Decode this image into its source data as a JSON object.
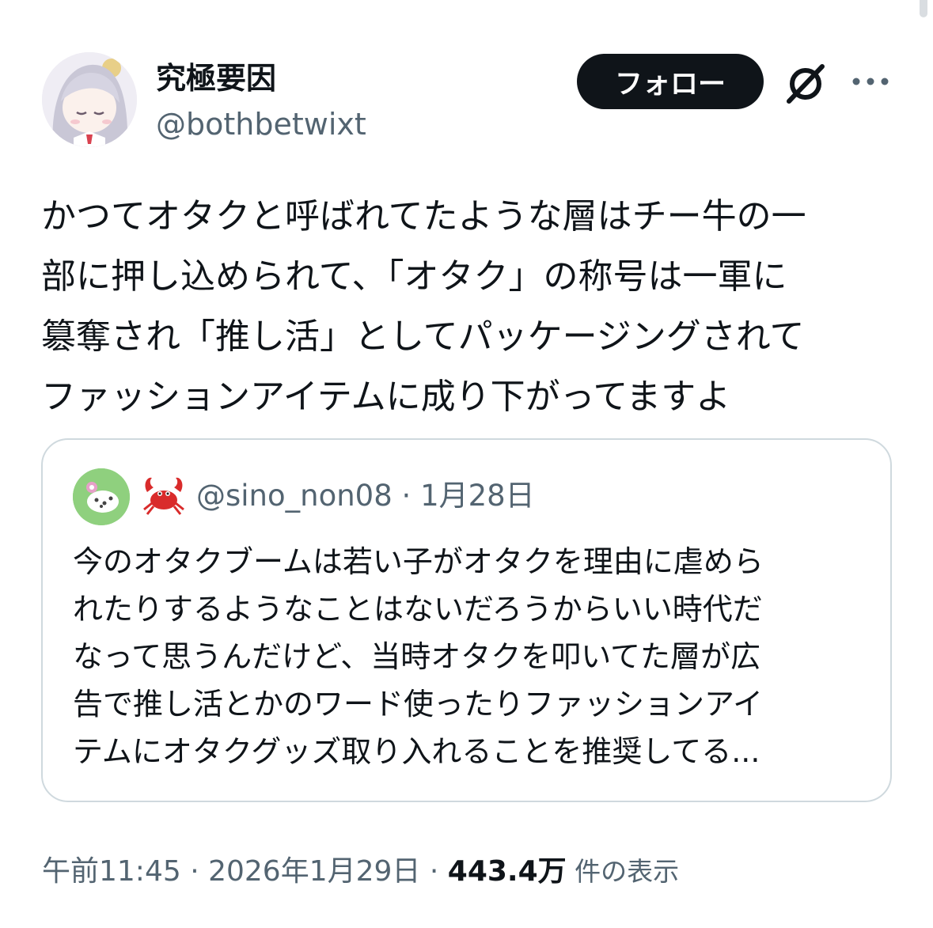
{
  "author": {
    "display_name": "究極要因",
    "handle": "@bothbetwixt"
  },
  "header_actions": {
    "follow_label": "フォロー",
    "grok_icon": "grok-slash-icon",
    "more_icon": "more-horizontal-icon"
  },
  "tweet": {
    "lines": [
      "かつてオタクと呼ばれてたような層はチー牛の一",
      "部に押し込められて、「オタク」の称号は一軍に",
      "簒奪され「推し活」としてパッケージングされて",
      "ファッションアイテムに成り下がってますよ"
    ]
  },
  "quote": {
    "emoji": "🦀",
    "handle": "@sino_non08",
    "separator": " · ",
    "date": "1月28日",
    "lines": [
      "今のオタクブームは若い子がオタクを理由に虐めら",
      "れたりするようなことはないだろうからいい時代だ",
      "なって思うんだけど、当時オタクを叩いてた層が広",
      "告で推し活とかのワード使ったりファッションアイ",
      "テムにオタクグッズ取り入れることを推奨してる..."
    ]
  },
  "footer": {
    "time": "午前11:45",
    "sep1": " · ",
    "date": "2026年1月29日",
    "sep2": " · ",
    "views_count": "443.4万",
    "views_label": " 件の表示"
  },
  "colors": {
    "text_primary": "#0f1419",
    "text_secondary": "#536471",
    "border": "#cfd9de",
    "button_bg": "#0f1419",
    "button_text": "#ffffff"
  }
}
